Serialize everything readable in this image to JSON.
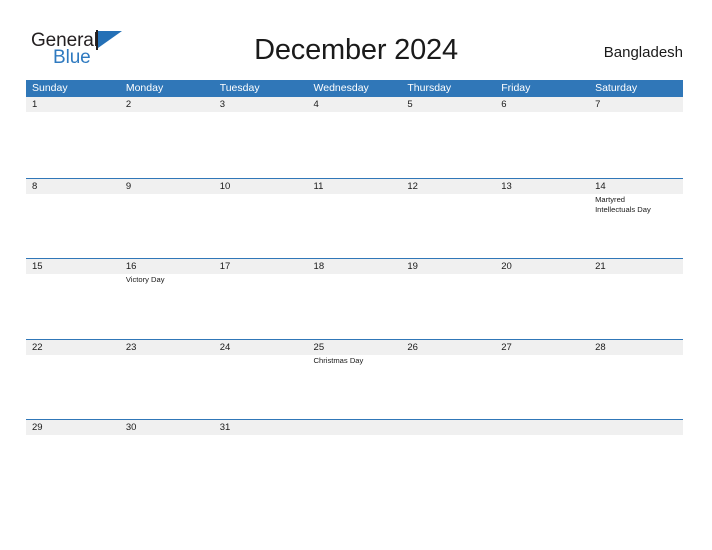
{
  "brand": {
    "name_part1": "General",
    "name_part2": "Blue",
    "flag_icon": "blue-flag-triangle-icon"
  },
  "header": {
    "title": "December 2024",
    "country": "Bangladesh"
  },
  "colors": {
    "header_blue": "#3077b8",
    "date_band_gray": "#f0f0f0",
    "brand_blue": "#2f7ac0",
    "text_dark": "#1a1a1a"
  },
  "calendar": {
    "weekdays": [
      "Sunday",
      "Monday",
      "Tuesday",
      "Wednesday",
      "Thursday",
      "Friday",
      "Saturday"
    ],
    "weeks": [
      {
        "days": [
          {
            "num": "1",
            "events": []
          },
          {
            "num": "2",
            "events": []
          },
          {
            "num": "3",
            "events": []
          },
          {
            "num": "4",
            "events": []
          },
          {
            "num": "5",
            "events": []
          },
          {
            "num": "6",
            "events": []
          },
          {
            "num": "7",
            "events": []
          }
        ]
      },
      {
        "days": [
          {
            "num": "8",
            "events": []
          },
          {
            "num": "9",
            "events": []
          },
          {
            "num": "10",
            "events": []
          },
          {
            "num": "11",
            "events": []
          },
          {
            "num": "12",
            "events": []
          },
          {
            "num": "13",
            "events": []
          },
          {
            "num": "14",
            "events": [
              "Martyred",
              "Intellectuals Day"
            ]
          }
        ]
      },
      {
        "days": [
          {
            "num": "15",
            "events": []
          },
          {
            "num": "16",
            "events": [
              "Victory Day"
            ]
          },
          {
            "num": "17",
            "events": []
          },
          {
            "num": "18",
            "events": []
          },
          {
            "num": "19",
            "events": []
          },
          {
            "num": "20",
            "events": []
          },
          {
            "num": "21",
            "events": []
          }
        ]
      },
      {
        "days": [
          {
            "num": "22",
            "events": []
          },
          {
            "num": "23",
            "events": []
          },
          {
            "num": "24",
            "events": []
          },
          {
            "num": "25",
            "events": [
              "Christmas Day"
            ]
          },
          {
            "num": "26",
            "events": []
          },
          {
            "num": "27",
            "events": []
          },
          {
            "num": "28",
            "events": []
          }
        ]
      },
      {
        "days": [
          {
            "num": "29",
            "events": []
          },
          {
            "num": "30",
            "events": []
          },
          {
            "num": "31",
            "events": []
          },
          {
            "num": "",
            "events": []
          },
          {
            "num": "",
            "events": []
          },
          {
            "num": "",
            "events": []
          },
          {
            "num": "",
            "events": []
          }
        ]
      }
    ]
  }
}
